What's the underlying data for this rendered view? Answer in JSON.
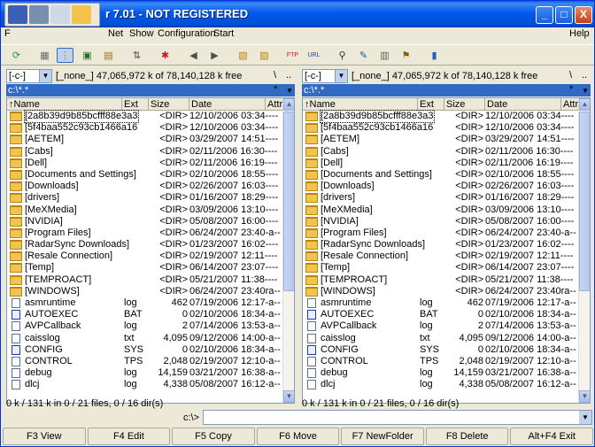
{
  "window": {
    "title": "r 7.01 - NOT REGISTERED",
    "controls": [
      "_",
      "□",
      "X"
    ]
  },
  "menu": {
    "items": [
      {
        "label": "F"
      },
      {
        "label": "Net"
      },
      {
        "label": "Show"
      },
      {
        "label": "Configuration"
      },
      {
        "label": "Start"
      }
    ],
    "help": "Help"
  },
  "panels": {
    "left": {
      "drive": "[-c-]",
      "drive_label": "[_none_]",
      "free": "47,065,972 k of 78,140,128 k free",
      "root_btn": "\\",
      "up_btn": "..",
      "path": "c:\\*.*",
      "path_star": "*",
      "path_arrow": "▼",
      "status": "0 k / 131 k in 0 / 21 files, 0 / 16 dir(s)"
    },
    "right": {
      "drive": "[-c-]",
      "drive_label": "[_none_]",
      "free": "47,065,972 k of 78,140,128 k free",
      "root_btn": "\\",
      "up_btn": "..",
      "path": "c:\\*.*",
      "path_star": "*",
      "path_arrow": "▼",
      "status": "0 k / 131 k in 0 / 21 files, 0 / 16 dir(s)"
    }
  },
  "columns": {
    "name": "↑Name",
    "ext": "Ext",
    "size": "Size",
    "date": "Date",
    "attr": "Attr"
  },
  "files": [
    {
      "name": "[2a8b39d9b85bcfff88e3a3]",
      "ext": "",
      "size": "<DIR>",
      "date": "12/10/2006 03:34----",
      "type": "folder"
    },
    {
      "name": "[5f4baa552c93cb1466a16b..]",
      "ext": "",
      "size": "<DIR>",
      "date": "12/10/2006 03:34----",
      "type": "folder"
    },
    {
      "name": "[AETEM]",
      "ext": "",
      "size": "<DIR>",
      "date": "03/29/2007 14:51----",
      "type": "folder"
    },
    {
      "name": "[Cabs]",
      "ext": "",
      "size": "<DIR>",
      "date": "02/11/2006 16:30----",
      "type": "folder"
    },
    {
      "name": "[Dell]",
      "ext": "",
      "size": "<DIR>",
      "date": "02/11/2006 16:19----",
      "type": "folder"
    },
    {
      "name": "[Documents and Settings]",
      "ext": "",
      "size": "<DIR>",
      "date": "02/10/2006 18:55----",
      "type": "folder"
    },
    {
      "name": "[Downloads]",
      "ext": "",
      "size": "<DIR>",
      "date": "02/26/2007 16:03----",
      "type": "folder"
    },
    {
      "name": "[drivers]",
      "ext": "",
      "size": "<DIR>",
      "date": "01/16/2007 18:29----",
      "type": "folder"
    },
    {
      "name": "[MeXMedia]",
      "ext": "",
      "size": "<DIR>",
      "date": "03/09/2006 13:10----",
      "type": "folder"
    },
    {
      "name": "[NVIDIA]",
      "ext": "",
      "size": "<DIR>",
      "date": "05/08/2007 16:00----",
      "type": "folder"
    },
    {
      "name": "[Program Files]",
      "ext": "",
      "size": "<DIR>",
      "date": "06/24/2007 23:40-a--",
      "type": "folder"
    },
    {
      "name": "[RadarSync Downloads]",
      "ext": "",
      "size": "<DIR>",
      "date": "01/23/2007 16:02----",
      "type": "folder"
    },
    {
      "name": "[Resale Connection]",
      "ext": "",
      "size": "<DIR>",
      "date": "02/19/2007 12:11----",
      "type": "folder"
    },
    {
      "name": "[Temp]",
      "ext": "",
      "size": "<DIR>",
      "date": "06/14/2007 23:07----",
      "type": "folder"
    },
    {
      "name": "[TEMPROACT]",
      "ext": "",
      "size": "<DIR>",
      "date": "05/21/2007 11:38----",
      "type": "folder"
    },
    {
      "name": "[WINDOWS]",
      "ext": "",
      "size": "<DIR>",
      "date": "06/24/2007 23:40ra--",
      "type": "folder"
    },
    {
      "name": "asmruntime",
      "ext": "log",
      "size": "462",
      "date": "07/19/2006 12:17-a--",
      "type": "file"
    },
    {
      "name": "AUTOEXEC",
      "ext": "BAT",
      "size": "0",
      "date": "02/10/2006 18:34-a--",
      "type": "sys"
    },
    {
      "name": "AVPCallback",
      "ext": "log",
      "size": "2",
      "date": "07/14/2006 13:53-a--",
      "type": "file"
    },
    {
      "name": "caisslog",
      "ext": "txt",
      "size": "4,095",
      "date": "09/12/2006 14:00-a--",
      "type": "file"
    },
    {
      "name": "CONFIG",
      "ext": "SYS",
      "size": "0",
      "date": "02/10/2006 18:34-a--",
      "type": "sys"
    },
    {
      "name": "CONTROL",
      "ext": "TPS",
      "size": "2,048",
      "date": "02/19/2007 12:10-a--",
      "type": "file"
    },
    {
      "name": "debug",
      "ext": "log",
      "size": "14,159",
      "date": "03/21/2007 16:38-a--",
      "type": "file"
    },
    {
      "name": "dlcj",
      "ext": "log",
      "size": "4,338",
      "date": "05/08/2007 16:12-a--",
      "type": "file"
    }
  ],
  "cmdline": {
    "prompt": "c:\\>",
    "value": ""
  },
  "fkeys": [
    "F3 View",
    "F4 Edit",
    "F5 Copy",
    "F6 Move",
    "F7 NewFolder",
    "F8 Delete",
    "Alt+F4 Exit"
  ],
  "icons": {
    "toolbar": [
      "refresh-icon",
      "icons-view-icon",
      "list-view-icon",
      "thumbnail-view-icon",
      "tree-view-icon",
      "sync-icon",
      "clear-icon",
      "back-icon",
      "forward-icon",
      "pack-icon",
      "unpack-icon",
      "ftp-icon",
      "url-icon",
      "search-icon",
      "rename-icon",
      "compare-icon",
      "sync-dirs-icon",
      "notepad-icon"
    ]
  },
  "colors": {
    "title_bar": "#0058ee",
    "path_highlight": "#316ac5",
    "folder": "#f2c44e"
  }
}
